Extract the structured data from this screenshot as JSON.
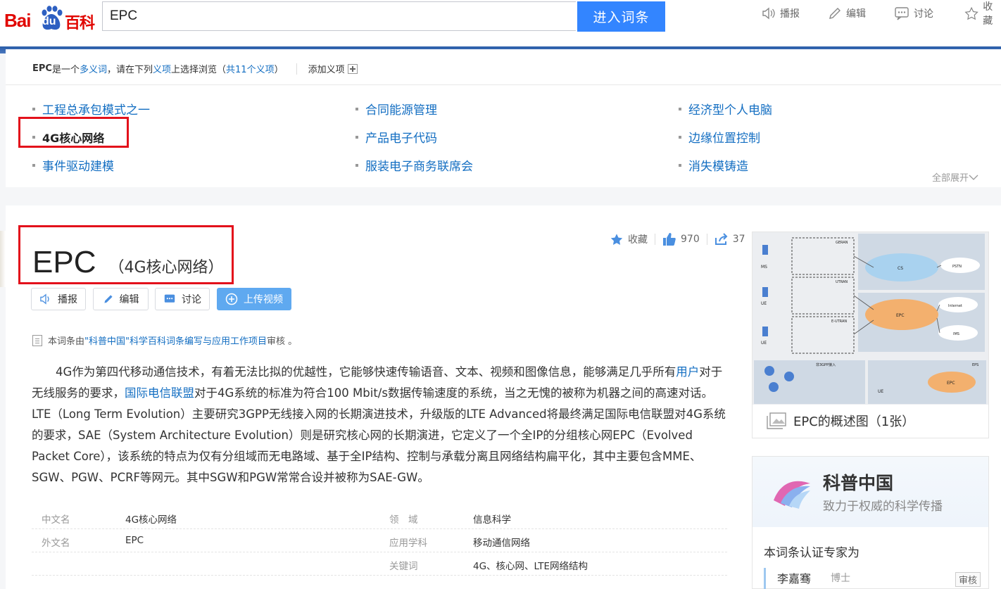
{
  "header": {
    "logo_bai": "Bai",
    "logo_du": "du",
    "logo_baike": "百科",
    "search_value": "EPC",
    "search_button": "进入词条",
    "tools": [
      {
        "label": "播报",
        "icon": "speaker-icon"
      },
      {
        "label": "编辑",
        "icon": "pencil-icon"
      },
      {
        "label": "讨论",
        "icon": "chat-icon"
      },
      {
        "label": "收藏",
        "icon": "star-icon"
      }
    ]
  },
  "polysemy": {
    "term": "EPC",
    "text_1": "是一个",
    "multi_word": "多义词",
    "text_2": "，请在下列",
    "meaning_word": "义项",
    "text_3": "上选择浏览（",
    "count": "共11个义项",
    "text_4": "）",
    "add_meaning": "添加义项",
    "items": [
      "工程总承包模式之一",
      "合同能源管理",
      "经济型个人电脑",
      "4G核心网络",
      "产品电子代码",
      "边缘位置控制",
      "事件驱动建模",
      "服装电子商务联席会",
      "消失模铸造"
    ],
    "current_index": 3,
    "expand_all": "全部展开"
  },
  "article": {
    "title": "EPC",
    "subtitle": "（4G核心网络）",
    "favorite_label": "收藏",
    "like_count": "970",
    "share_count": "37",
    "buttons": {
      "broadcast": "播报",
      "edit": "编辑",
      "discuss": "讨论",
      "upload_video": "上传视频"
    },
    "review": {
      "prefix": "本词条由",
      "link": "\"科普中国\"科学百科词条编写与应用工作项目",
      "suffix": " 审核 。"
    },
    "summary": {
      "p1": "4G作为第四代移动通信技术，有着无法比拟的优越性，它能够快速传输语音、文本、视频和图像信息，能够满足几乎所有",
      "link1": "用户",
      "p2": "对于无线服务的要求，",
      "link2": "国际电信联盟",
      "p3": "对于4G系统的标准为符合100 Mbit/s数据传输速度的系统，当之无愧的被称为机器之间的高速对话。LTE（Long Term Evolution）主要研究3GPP无线接入网的长期演进技术，升级版的LTE Advanced将最终满足国际电信联盟对4G系统的要求，SAE（System Architecture Evolution）则是研究核心网的长期演进，它定义了一个全IP的分组核心网EPC（Evolved Packet Core），该系统的特点为仅有分组域而无电路域、基于全IP结构、控制与承载分离且网络结构扁平化，其中主要包含MME、SGW、PGW、PCRF等网元。其中SGW和PGW常常合设并被称为SAE-GW。"
    },
    "basic_info": {
      "rows": [
        {
          "n1": "中文名",
          "v1": "4G核心网络",
          "n2": "领　域",
          "v2": "信息科学"
        },
        {
          "n1": "外文名",
          "v1": "EPC",
          "n2": "应用学科",
          "v2": "移动通信网络"
        },
        {
          "n1": "",
          "v1": "",
          "n2": "关键词",
          "v2": "4G、核心网、LTE网络结构"
        }
      ]
    }
  },
  "sidebar": {
    "album_caption": "EPC的概述图（1张）",
    "diagram_labels": [
      "MS",
      "UE",
      "UE",
      "UE",
      "GERAN",
      "UTRAN",
      "E-UTRAN",
      "CS",
      "PSTN",
      "EPC",
      "Internet",
      "IMS",
      "非3GPP接入",
      "EPS",
      "EPC"
    ],
    "science": {
      "name": "科普中国",
      "slogan": "致力于权威的科学传播",
      "expert_title": "本词条认证专家为",
      "expert_name": "李嘉骞",
      "expert_degree": "博士",
      "expert_tag": "审核"
    }
  },
  "colors": {
    "brand_red": "#e10601",
    "brand_blue": "#3385ff",
    "link": "#136ec2",
    "highlight_box": "#e3111b"
  }
}
